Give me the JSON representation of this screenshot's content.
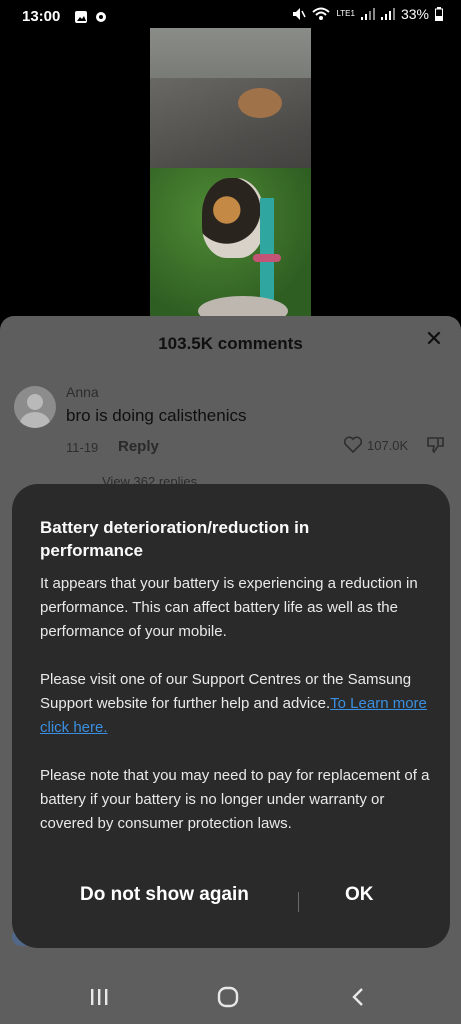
{
  "status_bar": {
    "time": "13:00",
    "battery_percent": "33%",
    "network_label": "LTE1",
    "icons": [
      "gallery-icon",
      "settings-icon",
      "mute-icon",
      "wifi-icon",
      "signal-icon",
      "battery-icon"
    ]
  },
  "comments": {
    "header_title": "103.5K comments",
    "items": [
      {
        "author": "Anna",
        "text": "bro is doing calisthenics",
        "date": "11-19",
        "reply_label": "Reply",
        "likes": "107.0K",
        "view_replies_label": "View 362 replies"
      }
    ]
  },
  "dialog": {
    "title": "Battery deterioration/reduction in performance",
    "paragraph1": "It appears that your battery is experiencing a reduction in performance. This can affect battery life as well as the performance of your mobile.",
    "paragraph2": "Please visit one of our Support Centres or the Samsung Support website for further help and advice.",
    "link_text": "To Learn more click here.",
    "paragraph3": "Please note that you may need to pay for replacement of a battery if your battery is no longer under warranty or covered by consumer protection laws.",
    "buttons": {
      "dont_show": "Do not show again",
      "ok": "OK"
    }
  },
  "colors": {
    "dialog_bg": "#2a2a2a",
    "link": "#3b8fe0",
    "sheet_bg": "#5e5e5e"
  }
}
